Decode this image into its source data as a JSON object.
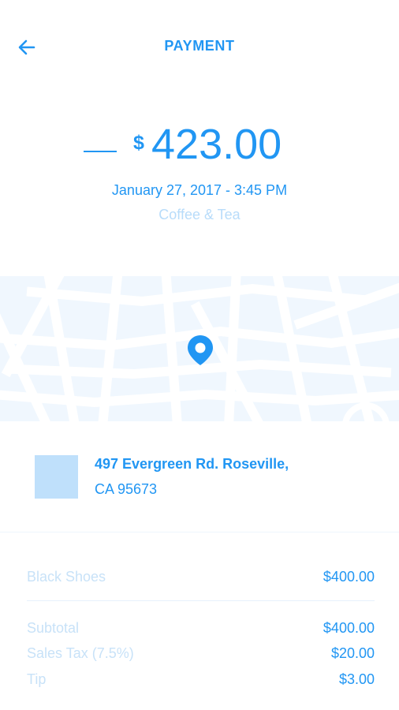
{
  "header": {
    "title": "PAYMENT",
    "back_icon": "arrow-left-icon"
  },
  "payment": {
    "currency_symbol": "$",
    "amount": "423.00",
    "datetime": "January 27, 2017 - 3:45 PM",
    "category": "Coffee & Tea"
  },
  "map": {
    "pin_icon": "location-pin-icon"
  },
  "address": {
    "line1": "497 Evergreen Rd. Roseville,",
    "line2": "CA 95673"
  },
  "items": [
    {
      "label": "Black Shoes",
      "value": "$400.00"
    }
  ],
  "summary": {
    "subtotal": {
      "label": "Subtotal",
      "value": "$400.00"
    },
    "tax": {
      "label": "Sales Tax (7.5%)",
      "value": "$20.00"
    },
    "tip": {
      "label": "Tip",
      "value": "$3.00"
    }
  },
  "colors": {
    "accent": "#2196f3",
    "muted": "#c8e2f8",
    "map_bg": "#f0f7fe"
  }
}
